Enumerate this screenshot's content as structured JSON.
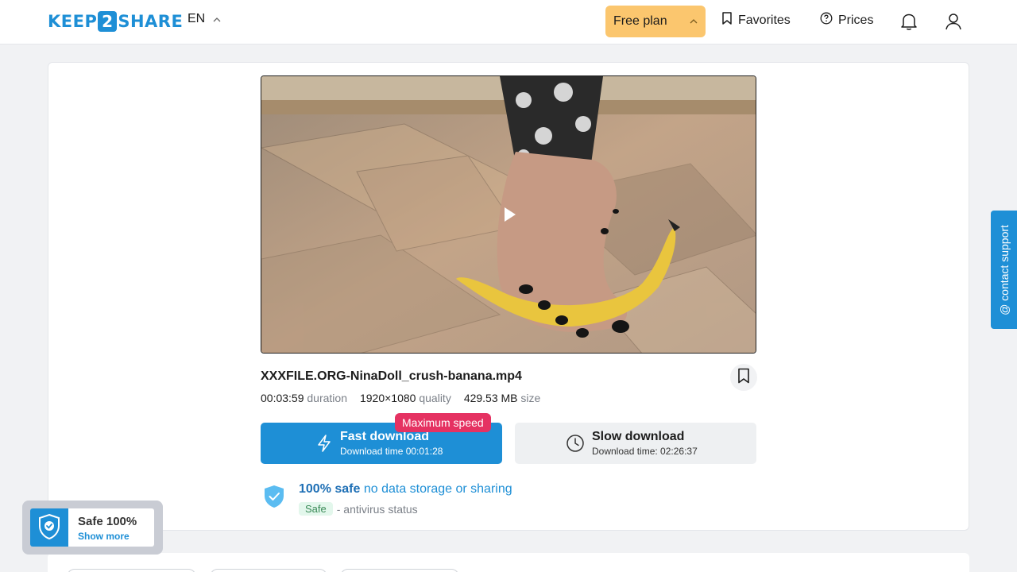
{
  "header": {
    "logo_left": "KEEP",
    "logo_mid": "2",
    "logo_right": "SHARE",
    "language": "EN",
    "plan_label": "Free plan",
    "favorites_label": "Favorites",
    "prices_label": "Prices"
  },
  "file": {
    "name": "XXXFILE.ORG-NinaDoll_crush-banana.mp4",
    "duration_value": "00:03:59",
    "duration_label": "duration",
    "quality_value": "1920×1080",
    "quality_label": "quality",
    "size_value": "429.53 MB",
    "size_label": "size"
  },
  "download": {
    "badge": "Maximum speed",
    "fast_title": "Fast download",
    "fast_sub": "Download time 00:01:28",
    "slow_title": "Slow download",
    "slow_sub": "Download time: 02:26:37"
  },
  "safety": {
    "strong": "100% safe",
    "rest": "no data storage or sharing",
    "tag": "Safe",
    "status": "- antivirus status"
  },
  "support_label": "@ contact support",
  "safe_widget": {
    "title": "Safe 100%",
    "link": "Show more"
  },
  "colors": {
    "accent": "#1e8fd6",
    "plan": "#fbc66e",
    "badge": "#e53262"
  }
}
